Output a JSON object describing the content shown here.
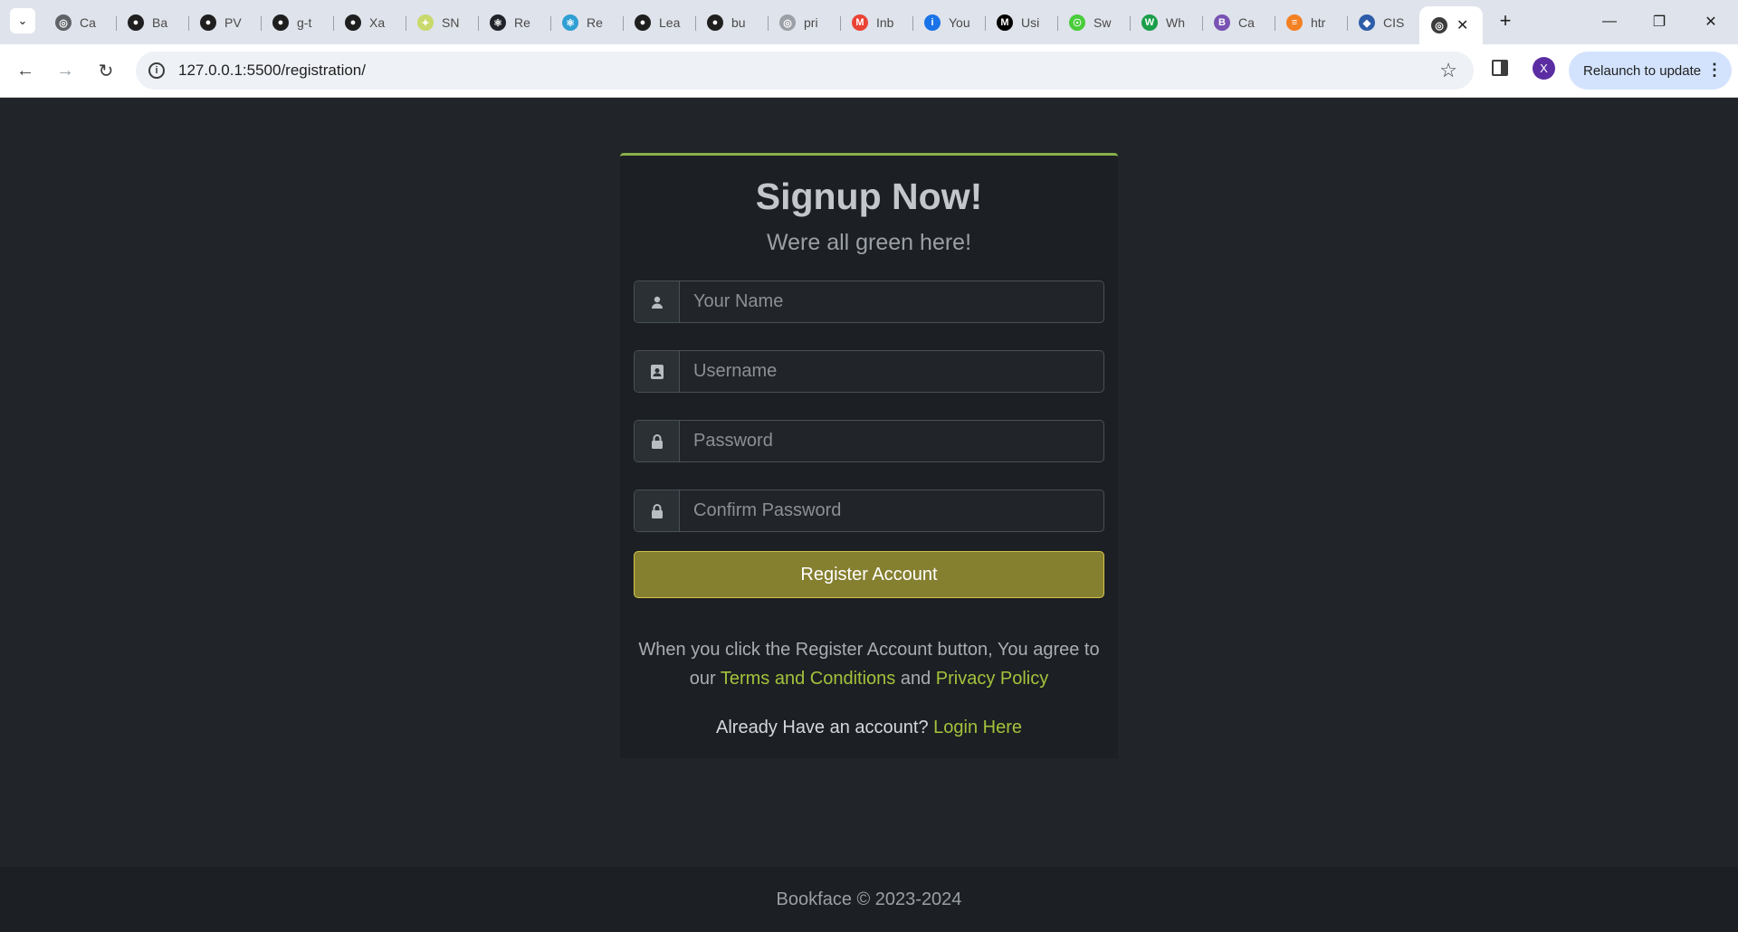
{
  "browser": {
    "tabs": [
      {
        "title": "Ca",
        "icon": "globe-icon",
        "color": "#5f6368"
      },
      {
        "title": "Ba",
        "icon": "github-icon",
        "color": "#1f1f1f"
      },
      {
        "title": "PV",
        "icon": "github-icon",
        "color": "#1f1f1f"
      },
      {
        "title": "g-t",
        "icon": "github-icon",
        "color": "#1f1f1f"
      },
      {
        "title": "Xa",
        "icon": "github-icon",
        "color": "#1f1f1f"
      },
      {
        "title": "SN",
        "icon": "leaf-icon",
        "color": "#c9d96b"
      },
      {
        "title": "Re",
        "icon": "react-icon",
        "color": "#20232a"
      },
      {
        "title": "Re",
        "icon": "react-icon",
        "color": "#2f9fd4"
      },
      {
        "title": "Lea",
        "icon": "github-icon",
        "color": "#1f1f1f"
      },
      {
        "title": "bu",
        "icon": "github-icon",
        "color": "#1f1f1f"
      },
      {
        "title": "pri",
        "icon": "globe-icon",
        "color": "#9aa0a6"
      },
      {
        "title": "Inb",
        "icon": "gmail-icon",
        "color": "#ea4335"
      },
      {
        "title": "You",
        "icon": "info-box-icon",
        "color": "#1a73e8"
      },
      {
        "title": "Usi",
        "icon": "medium-icon",
        "color": "#000000"
      },
      {
        "title": "Sw",
        "icon": "swagger-icon",
        "color": "#49cc3a"
      },
      {
        "title": "Wh",
        "icon": "w-icon",
        "color": "#1a9e4b"
      },
      {
        "title": "Ca",
        "icon": "bootstrap-icon",
        "color": "#7952b3"
      },
      {
        "title": "htr",
        "icon": "stackoverflow-icon",
        "color": "#f48024"
      },
      {
        "title": "CIS",
        "icon": "shield-icon",
        "color": "#2d5da8"
      },
      {
        "title": "",
        "icon": "globe-icon",
        "color": "#3c3c3c",
        "active": true
      }
    ],
    "url": "127.0.0.1:5500/registration/",
    "relaunch_label": "Relaunch to update",
    "profile_initial": "X"
  },
  "form": {
    "title": "Signup Now!",
    "subtitle": "Were all green here!",
    "name_placeholder": "Your Name",
    "username_placeholder": "Username",
    "password_placeholder": "Password",
    "confirm_placeholder": "Confirm Password",
    "register_label": "Register Account",
    "agree_prefix": "When you click the Register Account button, You agree to our",
    "terms_label": "Terms and Conditions",
    "and_word": "and",
    "privacy_label": "Privacy Policy",
    "login_prompt": "Already Have an account?",
    "login_label": "Login Here"
  },
  "footer": {
    "text": "Bookface © 2023-2024"
  },
  "colors": {
    "accent_green": "#a3c23c",
    "button_olive": "#857f30",
    "card_bg": "#1c1f23",
    "page_bg": "#212529"
  }
}
